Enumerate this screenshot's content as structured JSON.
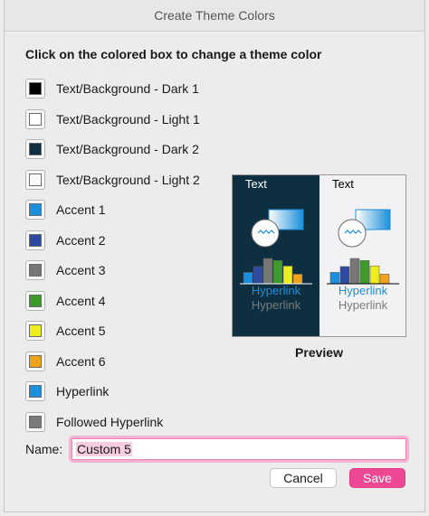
{
  "window": {
    "title": "Create Theme Colors"
  },
  "instruction": "Click on the colored box to change a theme color",
  "theme_colors": [
    {
      "label": "Text/Background - Dark 1",
      "color": "#000000"
    },
    {
      "label": "Text/Background - Light 1",
      "color": "#ffffff"
    },
    {
      "label": "Text/Background - Dark 2",
      "color": "#0e2f3f"
    },
    {
      "label": "Text/Background - Light 2",
      "color": "#ffffff"
    },
    {
      "label": "Accent 1",
      "color": "#1a8fdb"
    },
    {
      "label": "Accent 2",
      "color": "#2e4aa0"
    },
    {
      "label": "Accent 3",
      "color": "#767676"
    },
    {
      "label": "Accent 4",
      "color": "#3f9a2e"
    },
    {
      "label": "Accent 5",
      "color": "#eded1f"
    },
    {
      "label": "Accent 6",
      "color": "#f0a21c"
    },
    {
      "label": "Hyperlink",
      "color": "#1a8fdb"
    },
    {
      "label": "Followed Hyperlink",
      "color": "#7a7a7a"
    }
  ],
  "preview": {
    "caption": "Preview",
    "dark": {
      "text": "Text",
      "hyperlink": "Hyperlink",
      "followed": "Hyperlink"
    },
    "light": {
      "text": "Text",
      "hyperlink": "Hyperlink",
      "followed": "Hyperlink"
    },
    "bar_heights": [
      0.45,
      0.68,
      1.0,
      0.92,
      0.7,
      0.38
    ],
    "bar_colors": [
      "#1a8fdb",
      "#2e4aa0",
      "#767676",
      "#3f9a2e",
      "#eded1f",
      "#f0a21c"
    ]
  },
  "name_field": {
    "label": "Name:",
    "value": "Custom 5"
  },
  "buttons": {
    "cancel": "Cancel",
    "save": "Save"
  }
}
